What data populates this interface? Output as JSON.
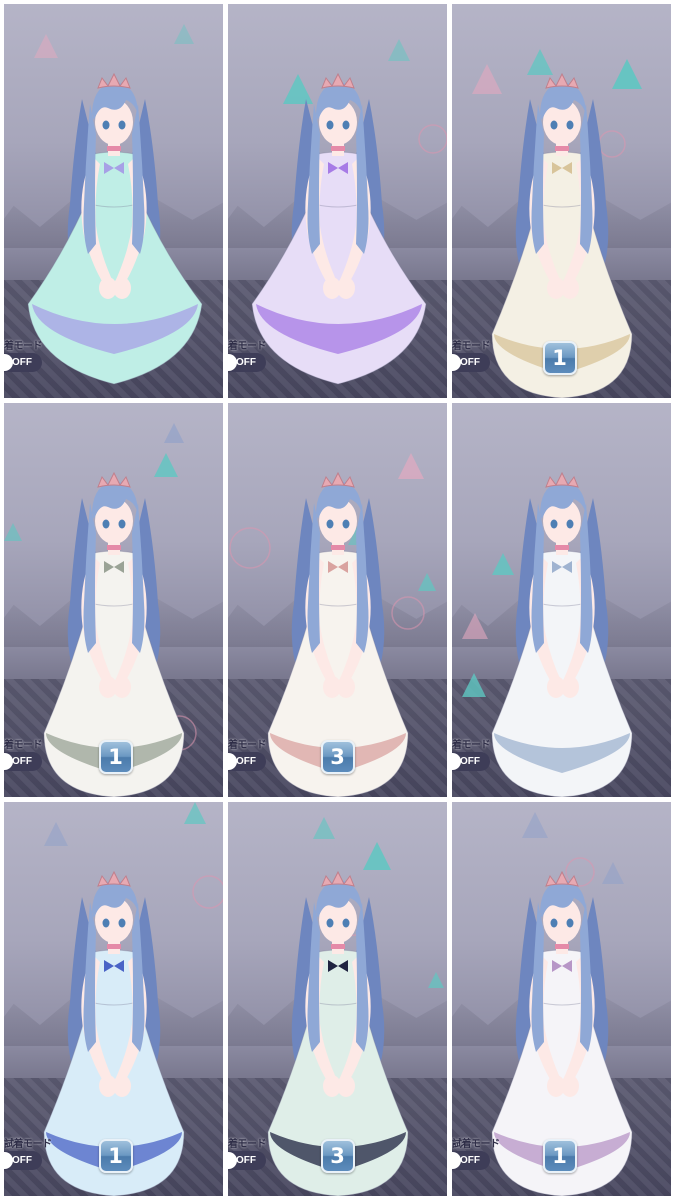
{
  "tiles": [
    {
      "id": "outfit-1",
      "dress": "mint ruffled ball gown with lavender trim",
      "dress_color": "#bfeee6",
      "accent_color": "#a7a0e6",
      "mode_label": "着モード",
      "toggle_text": "OFF",
      "badge": null
    },
    {
      "id": "outfit-2",
      "dress": "purple and white layered ball gown",
      "dress_color": "#e7ddf7",
      "accent_color": "#a77be6",
      "mode_label": "着モード",
      "toggle_text": "OFF",
      "badge": null
    },
    {
      "id": "outfit-3",
      "dress": "cream gown with gold sash",
      "dress_color": "#f4f0e4",
      "accent_color": "#d8c49a",
      "mode_label": "着モード",
      "toggle_text": "OFF",
      "badge": "1"
    },
    {
      "id": "outfit-4",
      "dress": "white puff-sleeve dress with green trim",
      "dress_color": "#f4f3ef",
      "accent_color": "#9aa396",
      "mode_label": "着モード",
      "toggle_text": "OFF",
      "badge": "1"
    },
    {
      "id": "outfit-5",
      "dress": "white floral dress with pink bow",
      "dress_color": "#f7f3ee",
      "accent_color": "#d9a3a0",
      "mode_label": "着モード",
      "toggle_text": "OFF",
      "badge": "3"
    },
    {
      "id": "outfit-6",
      "dress": "white lace dress with blue ribbon",
      "dress_color": "#f3f5f8",
      "accent_color": "#9fb3d0",
      "mode_label": "着モード",
      "toggle_text": "OFF",
      "badge": null
    },
    {
      "id": "outfit-7",
      "dress": "light blue gradient gown with blue bow",
      "dress_color": "#d8ecf8",
      "accent_color": "#4a63c6",
      "mode_label": "試着モード",
      "toggle_text": "OFF",
      "badge": "1"
    },
    {
      "id": "outfit-8",
      "dress": "mint lace dress with navy skirt",
      "dress_color": "#dfeee8",
      "accent_color": "#1f2340",
      "mode_label": "着モード",
      "toggle_text": "OFF",
      "badge": "3"
    },
    {
      "id": "outfit-9",
      "dress": "white lace gown with lilac bow",
      "dress_color": "#f5f4f8",
      "accent_color": "#b796c7",
      "mode_label": "試着モード",
      "toggle_text": "OFF",
      "badge": "1"
    }
  ],
  "colors": {
    "hair": "#8fa8d6",
    "hair_shadow": "#6e86bf",
    "skin": "#fde9e6",
    "tiara": "#e7a9b2",
    "triangle_teal": "#5fc7c2",
    "background_top": "#b5b4c7",
    "background_bottom": "#59586e"
  }
}
